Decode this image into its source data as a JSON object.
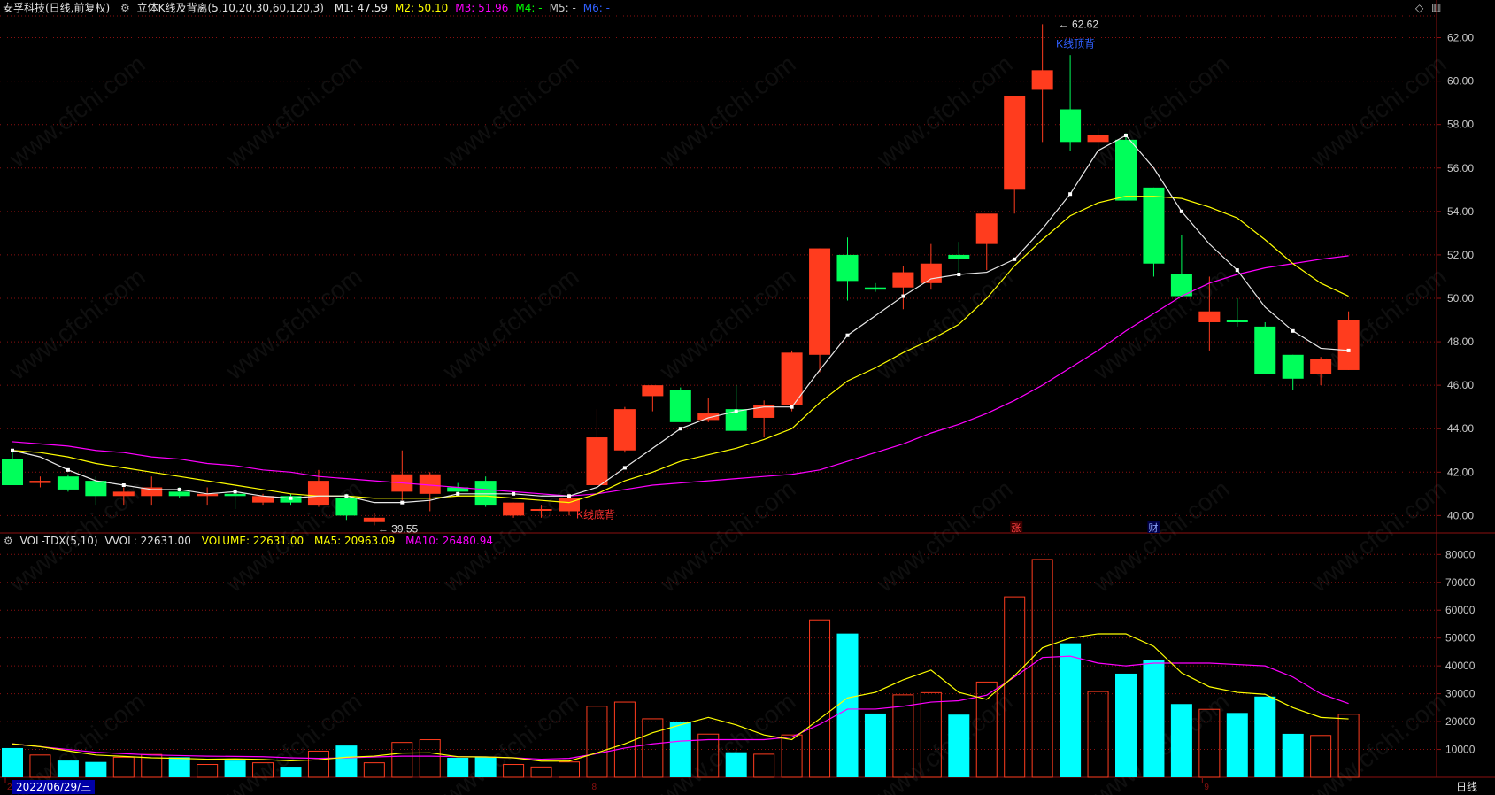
{
  "header": {
    "stock": "安孚科技(日线,前复权)",
    "indicator": "立体K线及背离(5,10,20,30,60,120,3)",
    "ma": [
      {
        "label": "M1: 47.59",
        "color": "#e8e8e8"
      },
      {
        "label": "M2: 50.10",
        "color": "#ffff00"
      },
      {
        "label": "M3: 51.96",
        "color": "#ff00ff"
      },
      {
        "label": "M4: -",
        "color": "#00ff00"
      },
      {
        "label": "M5: -",
        "color": "#c8c8c8"
      },
      {
        "label": "M6: -",
        "color": "#3060ff"
      }
    ]
  },
  "vol_header": {
    "name": "VOL-TDX(5,10)",
    "vvol": "VVOL: 22631.00",
    "volume": "VOLUME: 22631.00",
    "ma5": "MA5: 20963.09",
    "ma10": "MA10: 26480.94"
  },
  "annotations": {
    "high": "62.62",
    "low": "39.55",
    "top_div": "K线顶背",
    "bottom_div": "K线底背",
    "mark_zhang": "涨",
    "mark_cai": "财"
  },
  "footer": {
    "date": "2022/06/29/三",
    "period": "日线",
    "month_marks": [
      "2",
      "8",
      "9"
    ]
  },
  "price_axis": [
    "62.00",
    "60.00",
    "58.00",
    "56.00",
    "54.00",
    "52.00",
    "50.00",
    "48.00",
    "46.00",
    "44.00",
    "42.00",
    "40.00"
  ],
  "vol_axis": [
    "80000",
    "70000",
    "60000",
    "50000",
    "40000",
    "30000",
    "20000",
    "10000"
  ],
  "watermark": "www.cfchi.com",
  "colors": {
    "up": "#ff3c1e",
    "down": "#00ff5a",
    "vol_down": "#00ffff",
    "grid": "#8b1010",
    "axis_text": "#c8c8c8"
  },
  "chart_data": {
    "type": "candlestick",
    "ohlc": [
      [
        42.6,
        43.0,
        41.5,
        41.4
      ],
      [
        41.5,
        41.8,
        41.3,
        41.6
      ],
      [
        41.8,
        41.9,
        41.1,
        41.2
      ],
      [
        41.6,
        41.8,
        40.5,
        40.9
      ],
      [
        40.9,
        41.3,
        40.5,
        41.1
      ],
      [
        40.9,
        41.8,
        40.5,
        41.3
      ],
      [
        41.1,
        41.3,
        40.8,
        40.9
      ],
      [
        40.9,
        41.3,
        40.5,
        41.0
      ],
      [
        41.0,
        41.3,
        40.3,
        40.9
      ],
      [
        40.6,
        41.0,
        40.5,
        40.9
      ],
      [
        40.9,
        41.0,
        40.5,
        40.6
      ],
      [
        40.5,
        42.1,
        40.4,
        41.6
      ],
      [
        40.8,
        41.0,
        39.8,
        40.0
      ],
      [
        39.7,
        40.1,
        39.55,
        39.9
      ],
      [
        41.1,
        43.0,
        40.7,
        41.9
      ],
      [
        41.0,
        42.0,
        40.2,
        41.9
      ],
      [
        41.3,
        41.5,
        41.0,
        41.1
      ],
      [
        41.6,
        41.8,
        40.4,
        40.5
      ],
      [
        40.0,
        40.6,
        39.9,
        40.6
      ],
      [
        40.3,
        40.5,
        39.9,
        40.3
      ],
      [
        40.2,
        41.0,
        40.0,
        40.8
      ],
      [
        41.4,
        44.9,
        41.2,
        43.6
      ],
      [
        43.0,
        45.0,
        42.9,
        44.9
      ],
      [
        45.5,
        46.0,
        44.8,
        46.0
      ],
      [
        45.8,
        45.9,
        44.3,
        44.3
      ],
      [
        44.4,
        45.4,
        44.3,
        44.7
      ],
      [
        44.9,
        46.0,
        43.9,
        43.9
      ],
      [
        44.5,
        45.3,
        43.6,
        45.1
      ],
      [
        45.1,
        47.6,
        44.8,
        47.5
      ],
      [
        47.4,
        52.3,
        46.6,
        52.3
      ],
      [
        52.0,
        52.8,
        49.9,
        50.8
      ],
      [
        50.5,
        50.7,
        50.3,
        50.4
      ],
      [
        50.5,
        51.5,
        49.5,
        51.2
      ],
      [
        50.7,
        52.5,
        50.4,
        51.6
      ],
      [
        52.0,
        52.6,
        51.2,
        51.8
      ],
      [
        52.5,
        53.5,
        51.3,
        53.9
      ],
      [
        55.0,
        59.3,
        53.9,
        59.3
      ],
      [
        59.6,
        62.62,
        57.2,
        60.5
      ],
      [
        58.7,
        61.2,
        56.8,
        57.2
      ],
      [
        57.2,
        57.8,
        56.4,
        57.5
      ],
      [
        57.3,
        57.6,
        54.5,
        54.5
      ],
      [
        55.1,
        55.1,
        51.0,
        51.6
      ],
      [
        51.1,
        52.9,
        50.1,
        50.1
      ],
      [
        48.9,
        51.0,
        47.6,
        49.4
      ],
      [
        49.0,
        50.0,
        48.7,
        48.9
      ],
      [
        48.7,
        48.9,
        46.5,
        46.5
      ],
      [
        47.4,
        47.4,
        45.8,
        46.3
      ],
      [
        46.5,
        47.3,
        46.0,
        47.2
      ],
      [
        46.7,
        49.4,
        46.7,
        49.0
      ]
    ],
    "ma_m1": [
      43.0,
      42.7,
      42.1,
      41.6,
      41.4,
      41.2,
      41.2,
      41.0,
      41.1,
      40.9,
      40.8,
      40.9,
      40.9,
      40.6,
      40.6,
      40.7,
      41.0,
      41.0,
      41.0,
      40.9,
      40.9,
      41.3,
      42.2,
      43.1,
      44.0,
      44.5,
      44.8,
      45.0,
      45.0,
      46.7,
      48.3,
      49.2,
      50.1,
      50.9,
      51.1,
      51.2,
      51.8,
      53.2,
      54.8,
      56.8,
      57.5,
      56.0,
      54.0,
      52.5,
      51.3,
      49.6,
      48.5,
      47.7,
      47.6
    ],
    "ma_m2": [
      43.0,
      42.9,
      42.7,
      42.4,
      42.2,
      42.0,
      41.8,
      41.6,
      41.4,
      41.2,
      41.0,
      40.9,
      40.9,
      40.8,
      40.8,
      40.8,
      40.9,
      40.9,
      40.8,
      40.7,
      40.6,
      41.0,
      41.6,
      42.0,
      42.5,
      42.8,
      43.1,
      43.5,
      44.0,
      45.2,
      46.2,
      46.8,
      47.5,
      48.1,
      48.8,
      50.0,
      51.5,
      52.7,
      53.8,
      54.4,
      54.7,
      54.7,
      54.6,
      54.2,
      53.7,
      52.7,
      51.6,
      50.7,
      50.1
    ],
    "ma_m3": [
      43.4,
      43.3,
      43.2,
      43.0,
      42.9,
      42.7,
      42.6,
      42.4,
      42.3,
      42.1,
      42.0,
      41.8,
      41.7,
      41.6,
      41.5,
      41.4,
      41.3,
      41.2,
      41.1,
      41.0,
      40.9,
      41.0,
      41.2,
      41.4,
      41.5,
      41.6,
      41.7,
      41.8,
      41.9,
      42.1,
      42.5,
      42.9,
      43.3,
      43.8,
      44.2,
      44.7,
      45.3,
      46.0,
      46.8,
      47.6,
      48.5,
      49.3,
      50.1,
      50.7,
      51.1,
      51.4,
      51.6,
      51.8,
      51.96
    ],
    "volume": [
      10500,
      8000,
      6000,
      5500,
      7200,
      8200,
      7200,
      4600,
      6000,
      5200,
      3800,
      9400,
      11400,
      5200,
      12500,
      13500,
      7000,
      7200,
      4600,
      3700,
      5500,
      25500,
      27000,
      21000,
      20000,
      15500,
      9000,
      8300,
      15200,
      56500,
      51600,
      22900,
      29600,
      30400,
      22500,
      34200,
      64800,
      78200,
      48100,
      30800,
      37200,
      42100,
      26300,
      24400,
      23100,
      29000,
      15600,
      15000,
      22631
    ],
    "vol_ma5": [
      12000,
      11000,
      9500,
      8000,
      7500,
      7000,
      6800,
      6500,
      6600,
      6400,
      5900,
      6300,
      7200,
      7600,
      8700,
      8800,
      7400,
      7300,
      7000,
      5800,
      5800,
      8800,
      12000,
      16000,
      18800,
      21500,
      18800,
      15200,
      13500,
      21000,
      28500,
      30500,
      35000,
      38500,
      30500,
      28000,
      36500,
      46500,
      50000,
      51500,
      51500,
      47000,
      37500,
      32500,
      30500,
      29800,
      25000,
      21500,
      20963
    ],
    "vol_ma10": [
      12000,
      11000,
      10000,
      9000,
      8500,
      8000,
      7800,
      7600,
      7500,
      7400,
      7000,
      6800,
      7000,
      7300,
      7600,
      7600,
      7400,
      7300,
      7000,
      6500,
      6800,
      8500,
      10500,
      12000,
      13000,
      13500,
      13500,
      13500,
      14500,
      19000,
      24500,
      24500,
      25500,
      27000,
      27500,
      29500,
      36000,
      43000,
      43500,
      41000,
      40000,
      41000,
      41000,
      41000,
      40500,
      40000,
      36000,
      30000,
      26481
    ],
    "price_ylim": [
      39.2,
      63.0
    ],
    "vol_ylim": [
      0,
      82000
    ]
  }
}
